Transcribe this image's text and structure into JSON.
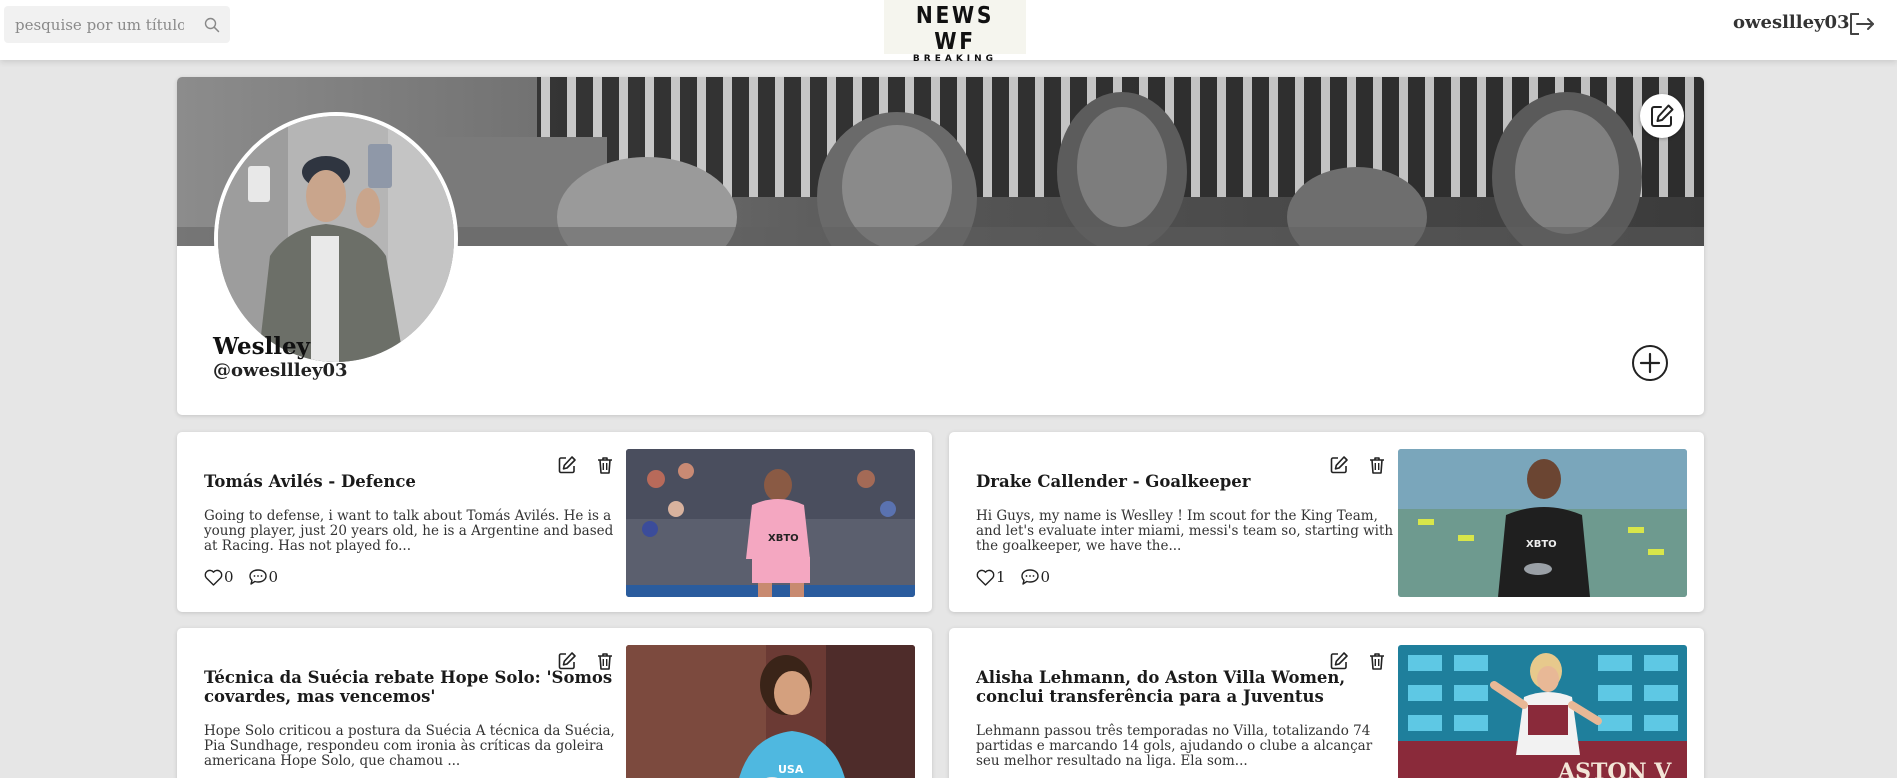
{
  "header": {
    "search_placeholder": "pesquise por um título",
    "logo_title": "NEWS WF",
    "logo_subtitle": "BREAKING",
    "username": "owesllley03"
  },
  "profile": {
    "name": "Weslley",
    "handle": "@owesllley03"
  },
  "posts": [
    {
      "title": "Tomás Avilés - Defence",
      "text": "Going to defense, i want to talk about Tomás Avilés. He is a young player, just 20 years old, he is a Argentine and based at Racing. Has not played fo...",
      "likes": "0",
      "comments": "0"
    },
    {
      "title": "Drake Callender - Goalkeeper",
      "text": "Hi Guys, my name is Weslley ! Im scout for the King Team, and let's evaluate inter miami, messi's team so, starting with the goalkeeper, we have the...",
      "likes": "1",
      "comments": "0"
    },
    {
      "title": "Técnica da Suécia rebate Hope Solo: 'Somos covardes, mas vencemos'",
      "text": "Hope Solo criticou a postura da Suécia A técnica da Suécia, Pia Sundhage, respondeu com ironia às críticas da goleira americana Hope Solo, que chamou ..."
    },
    {
      "title": "Alisha Lehmann, do Aston Villa Women, conclui transferência para a Juventus",
      "text": "Lehmann passou três temporadas no Villa, totalizando 74 partidas e marcando 14 gols, ajudando o clube a alcançar seu melhor resultado na liga. Ela som..."
    }
  ],
  "image_labels": {
    "sponsor": "XBTO",
    "jersey": "USA",
    "board": "ASTON V"
  },
  "colors": {
    "navbar": "#ffffff",
    "page_background": "#e6e6e6",
    "card": "#ffffff",
    "miami_pink": "#f4a7c1",
    "text_dark": "#1a1a1a"
  },
  "icons": {
    "search": "search-icon",
    "logout": "logout-icon",
    "banner_edit": "edit-icon",
    "add_post": "plus-circle-icon",
    "post_edit": "edit-icon",
    "post_delete": "trash-icon",
    "like": "heart-icon",
    "comment": "comment-icon"
  }
}
